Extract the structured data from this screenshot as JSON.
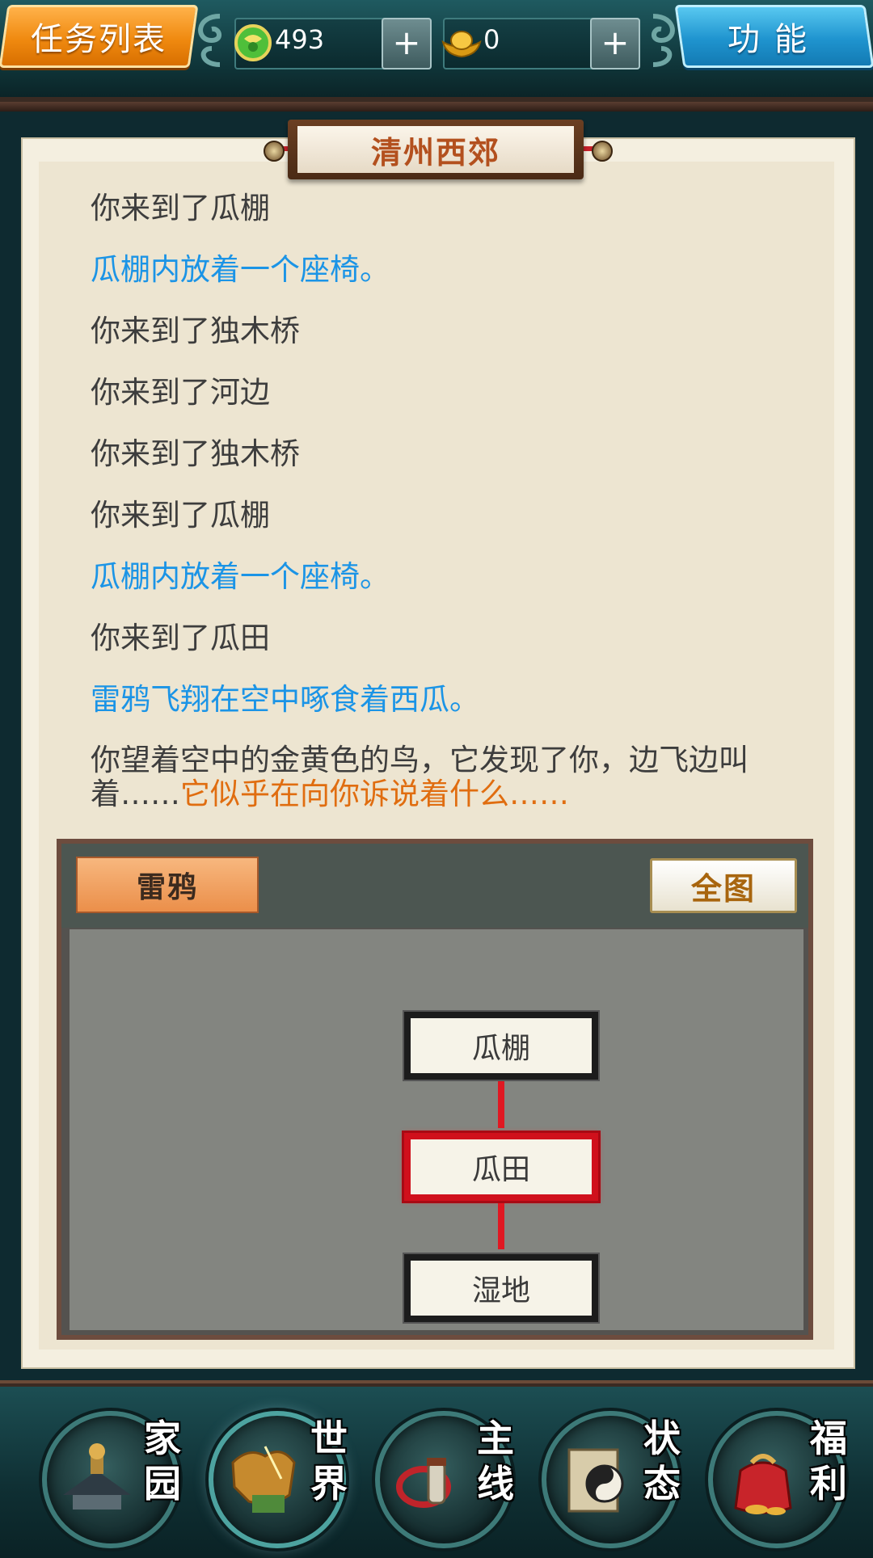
{
  "header": {
    "task_list_label": "任务列表",
    "function_label": "功能",
    "jade": {
      "value": "493",
      "plus": "+"
    },
    "gold": {
      "value": "0",
      "plus": "+"
    }
  },
  "panel": {
    "location_title": "清州西郊",
    "log": [
      {
        "text": "你来到了瓜棚",
        "style": "normal"
      },
      {
        "text": "瓜棚内放着一个座椅。",
        "style": "blue"
      },
      {
        "text": "你来到了独木桥",
        "style": "normal"
      },
      {
        "text": "你来到了河边",
        "style": "normal"
      },
      {
        "text": "你来到了独木桥",
        "style": "normal"
      },
      {
        "text": "你来到了瓜棚",
        "style": "normal"
      },
      {
        "text": "瓜棚内放着一个座椅。",
        "style": "blue"
      },
      {
        "text": "你来到了瓜田",
        "style": "normal"
      },
      {
        "text": "雷鸦飞翔在空中啄食着西瓜。",
        "style": "blue"
      }
    ],
    "last_line": {
      "normal": "你望着空中的金黄色的鸟，它发现了你，边飞边叫着……",
      "orange": "它似乎在向你诉说着什么……"
    }
  },
  "map": {
    "target_label": "雷鸦",
    "full_map_label": "全图",
    "nodes": [
      {
        "name": "瓜棚",
        "current": false
      },
      {
        "name": "瓜田",
        "current": true
      },
      {
        "name": "湿地",
        "current": false
      }
    ]
  },
  "bottom_nav": [
    {
      "label_top": "家",
      "label_bottom": "园",
      "icon": "home-icon",
      "active": false
    },
    {
      "label_top": "世",
      "label_bottom": "界",
      "icon": "world-icon",
      "active": true
    },
    {
      "label_top": "主",
      "label_bottom": "线",
      "icon": "main-quest-icon",
      "active": false
    },
    {
      "label_top": "状",
      "label_bottom": "态",
      "icon": "status-icon",
      "active": false
    },
    {
      "label_top": "福",
      "label_bottom": "利",
      "icon": "welfare-icon",
      "active": false
    }
  ],
  "colors": {
    "log_blue": "#1b94e6",
    "log_orange": "#e06d10",
    "current_node": "#d0101c",
    "task_button": "#f08a10",
    "function_button": "#1f94cf"
  }
}
